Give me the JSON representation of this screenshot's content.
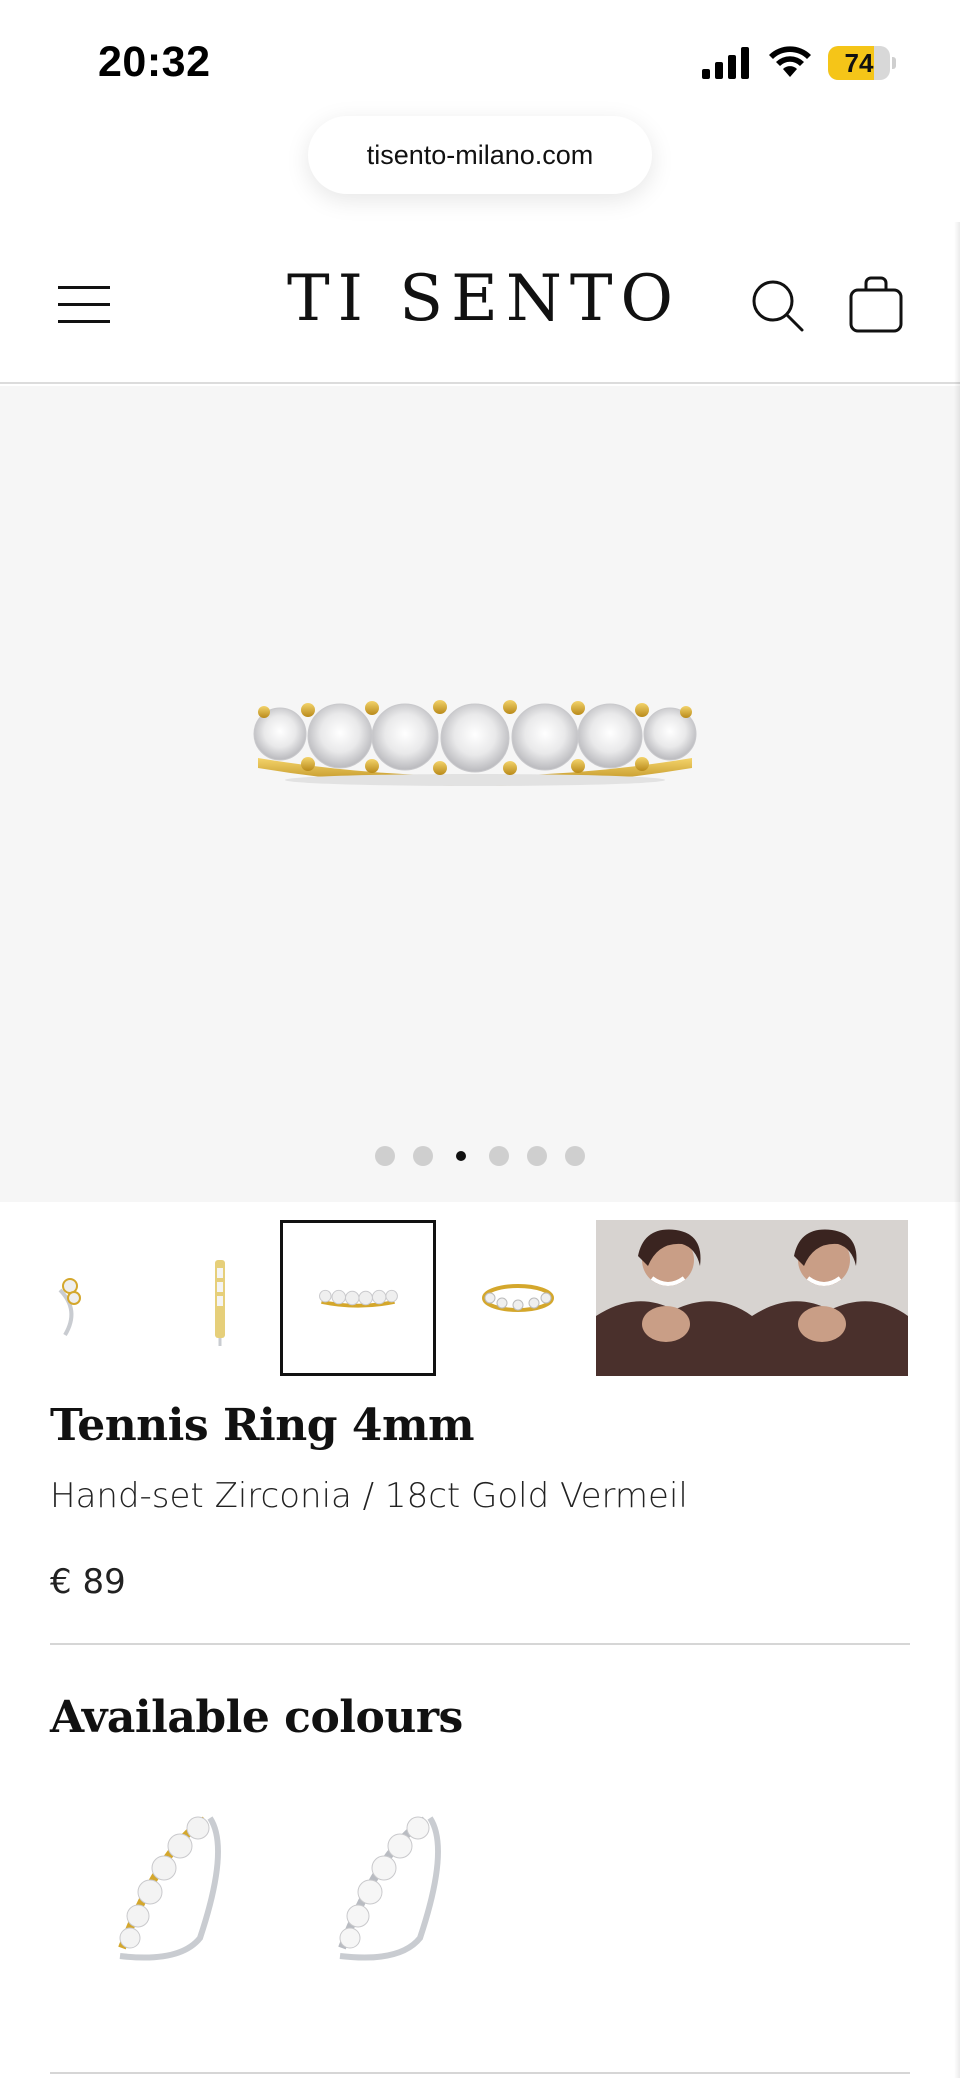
{
  "status_bar": {
    "time": "20:32",
    "battery_level": "74",
    "battery_fraction": 0.74,
    "icons": [
      "signal-icon",
      "wifi-icon",
      "battery-icon"
    ]
  },
  "browser": {
    "url": "tisento-milano.com"
  },
  "header": {
    "logo": "TI SENTO",
    "icons": [
      "menu-icon",
      "search-icon",
      "shopping-bag-icon"
    ]
  },
  "gallery": {
    "total_slides": 6,
    "active_slide": 3,
    "background": "#f6f6f6",
    "thumbnails": [
      {
        "label": "ring-side-view",
        "selected": false
      },
      {
        "label": "ring-profile-view",
        "selected": false
      },
      {
        "label": "ring-front-view",
        "selected": true
      },
      {
        "label": "ring-top-view",
        "selected": false
      },
      {
        "label": "model-photo-1",
        "selected": false
      },
      {
        "label": "model-photo-2",
        "selected": false
      }
    ]
  },
  "product": {
    "title": "Tennis Ring 4mm",
    "subtitle": "Hand-set Zirconia / 18ct Gold Vermeil",
    "price": "€ 89"
  },
  "colours": {
    "heading": "Available colours",
    "options": [
      {
        "name": "gold-vermeil",
        "color": "#d4a72c"
      },
      {
        "name": "silver",
        "color": "#c9ccd1"
      }
    ]
  }
}
